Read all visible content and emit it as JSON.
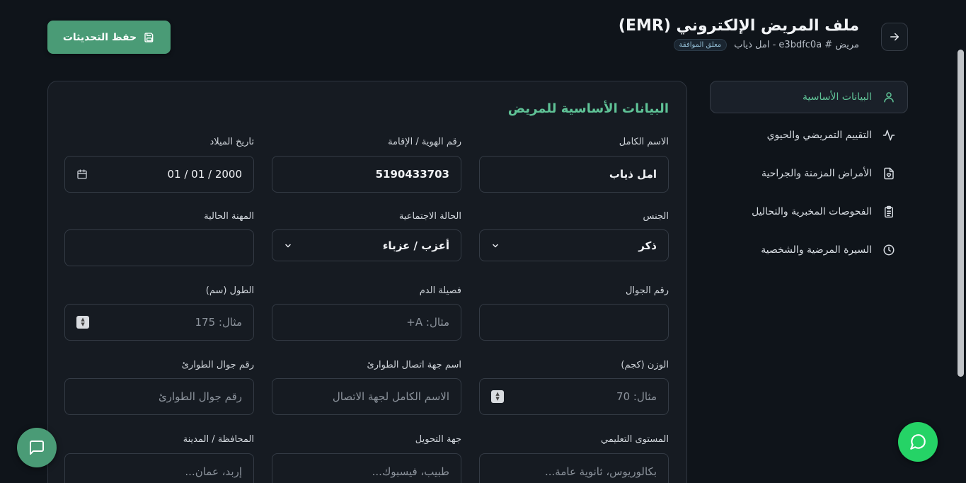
{
  "header": {
    "title": "ملف المريض الإلكتروني (EMR)",
    "patient_line": "مريض # e3bdfc0a - امل ذياب",
    "status_badge": "معلق الموافقة",
    "save_label": "حفظ التحديثات"
  },
  "sidebar": {
    "items": [
      {
        "label": "البيانات الأساسية",
        "icon": "user-icon",
        "active": true
      },
      {
        "label": "التقييم التمريضي والحيوي",
        "icon": "activity-icon",
        "active": false
      },
      {
        "label": "الأمراض المزمنة والجراحية",
        "icon": "file-heart-icon",
        "active": false
      },
      {
        "label": "الفحوصات المخبرية والتحاليل",
        "icon": "clipboard-list-icon",
        "active": false
      },
      {
        "label": "السيرة المرضية والشخصية",
        "icon": "clock-icon",
        "active": false
      }
    ]
  },
  "form": {
    "title": "البيانات الأساسية للمريض",
    "full_name": {
      "label": "الاسم الكامل",
      "value": "امل ذياب"
    },
    "national_id": {
      "label": "رقم الهوية / الإقامة",
      "value": "5190433703"
    },
    "birth_date": {
      "label": "تاريخ الميلاد",
      "value": "01 / 01 / 2000"
    },
    "gender": {
      "label": "الجنس",
      "value": "ذكر"
    },
    "marital_status": {
      "label": "الحالة الاجتماعية",
      "value": "أعزب / عزباء"
    },
    "occupation": {
      "label": "المهنة الحالية",
      "value": ""
    },
    "mobile": {
      "label": "رقم الجوال",
      "value": ""
    },
    "blood_type": {
      "label": "فصيلة الدم",
      "placeholder": "مثال: A+"
    },
    "height": {
      "label": "الطول (سم)",
      "placeholder": "مثال: 175"
    },
    "weight": {
      "label": "الوزن (كجم)",
      "placeholder": "مثال: 70"
    },
    "emergency_name": {
      "label": "اسم جهة اتصال الطوارئ",
      "placeholder": "الاسم الكامل لجهة الاتصال"
    },
    "emergency_phone": {
      "label": "رقم جوال الطوارئ",
      "placeholder": "رقم جوال الطوارئ"
    },
    "education": {
      "label": "المستوى التعليمي",
      "placeholder": "بكالوريوس، ثانوية عامة..."
    },
    "referral": {
      "label": "جهة التحويل",
      "placeholder": "طبيب، فيسبوك..."
    },
    "city": {
      "label": "المحافظة / المدينة",
      "placeholder": "إربد، عمان..."
    }
  },
  "colors": {
    "accent": "#4a9b76",
    "accent_text": "#5fc296",
    "background": "#0f141a",
    "card": "#161b22",
    "whatsapp": "#25d366"
  }
}
